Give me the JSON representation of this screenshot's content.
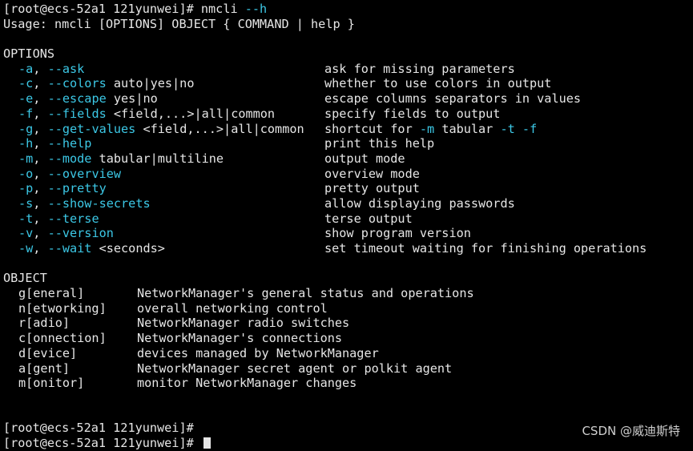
{
  "terminal": {
    "prompt_line": "[root@ecs-52a1 121yunwei]# ",
    "command": "nmcli ",
    "command_flag": "--h",
    "usage": "Usage: nmcli [OPTIONS] OBJECT { COMMAND | help }",
    "options_header": "OPTIONS",
    "options": [
      {
        "short": "-a",
        "sep": ", ",
        "long": "--ask",
        "arg": "",
        "desc": "ask for missing parameters"
      },
      {
        "short": "-c",
        "sep": ", ",
        "long": "--colors",
        "arg": " auto|yes|no",
        "desc": "whether to use colors in output"
      },
      {
        "short": "-e",
        "sep": ", ",
        "long": "--escape",
        "arg": " yes|no",
        "desc": "escape columns separators in values"
      },
      {
        "short": "-f",
        "sep": ", ",
        "long": "--fields",
        "arg": " <field,...>|all|common",
        "desc": "specify fields to output"
      },
      {
        "short": "-g",
        "sep": ", ",
        "long": "--get-values",
        "arg": " <field,...>|all|common",
        "desc": "shortcut for -m tabular -t -f"
      },
      {
        "short": "-h",
        "sep": ", ",
        "long": "--help",
        "arg": "",
        "desc": "print this help"
      },
      {
        "short": "-m",
        "sep": ", ",
        "long": "--mode",
        "arg": " tabular|multiline",
        "desc": "output mode"
      },
      {
        "short": "-o",
        "sep": ", ",
        "long": "--overview",
        "arg": "",
        "desc": "overview mode"
      },
      {
        "short": "-p",
        "sep": ", ",
        "long": "--pretty",
        "arg": "",
        "desc": "pretty output"
      },
      {
        "short": "-s",
        "sep": ", ",
        "long": "--show-secrets",
        "arg": "",
        "desc": "allow displaying passwords"
      },
      {
        "short": "-t",
        "sep": ", ",
        "long": "--terse",
        "arg": "",
        "desc": "terse output"
      },
      {
        "short": "-v",
        "sep": ", ",
        "long": "--version",
        "arg": "",
        "desc": "show program version"
      },
      {
        "short": "-w",
        "sep": ", ",
        "long": "--wait",
        "arg": " <seconds>",
        "desc": "set timeout waiting for finishing operations"
      }
    ],
    "shortcut_desc_parts": [
      "shortcut for ",
      "-m",
      " tabular ",
      "-t",
      " ",
      "-f"
    ],
    "object_header": "OBJECT",
    "objects": [
      {
        "name": "g[eneral]",
        "desc": "NetworkManager's general status and operations"
      },
      {
        "name": "n[etworking]",
        "desc": "overall networking control"
      },
      {
        "name": "r[adio]",
        "desc": "NetworkManager radio switches"
      },
      {
        "name": "c[onnection]",
        "desc": "NetworkManager's connections"
      },
      {
        "name": "d[evice]",
        "desc": "devices managed by NetworkManager"
      },
      {
        "name": "a[gent]",
        "desc": "NetworkManager secret agent or polkit agent"
      },
      {
        "name": "m[onitor]",
        "desc": "monitor NetworkManager changes"
      }
    ],
    "final_prompts": [
      "[root@ecs-52a1 121yunwei]#",
      "[root@ecs-52a1 121yunwei]# "
    ]
  },
  "watermark": "CSDN @威迪斯特",
  "colors": {
    "background": "#000000",
    "text": "#e6e6e6",
    "flag": "#3cc8e6"
  }
}
